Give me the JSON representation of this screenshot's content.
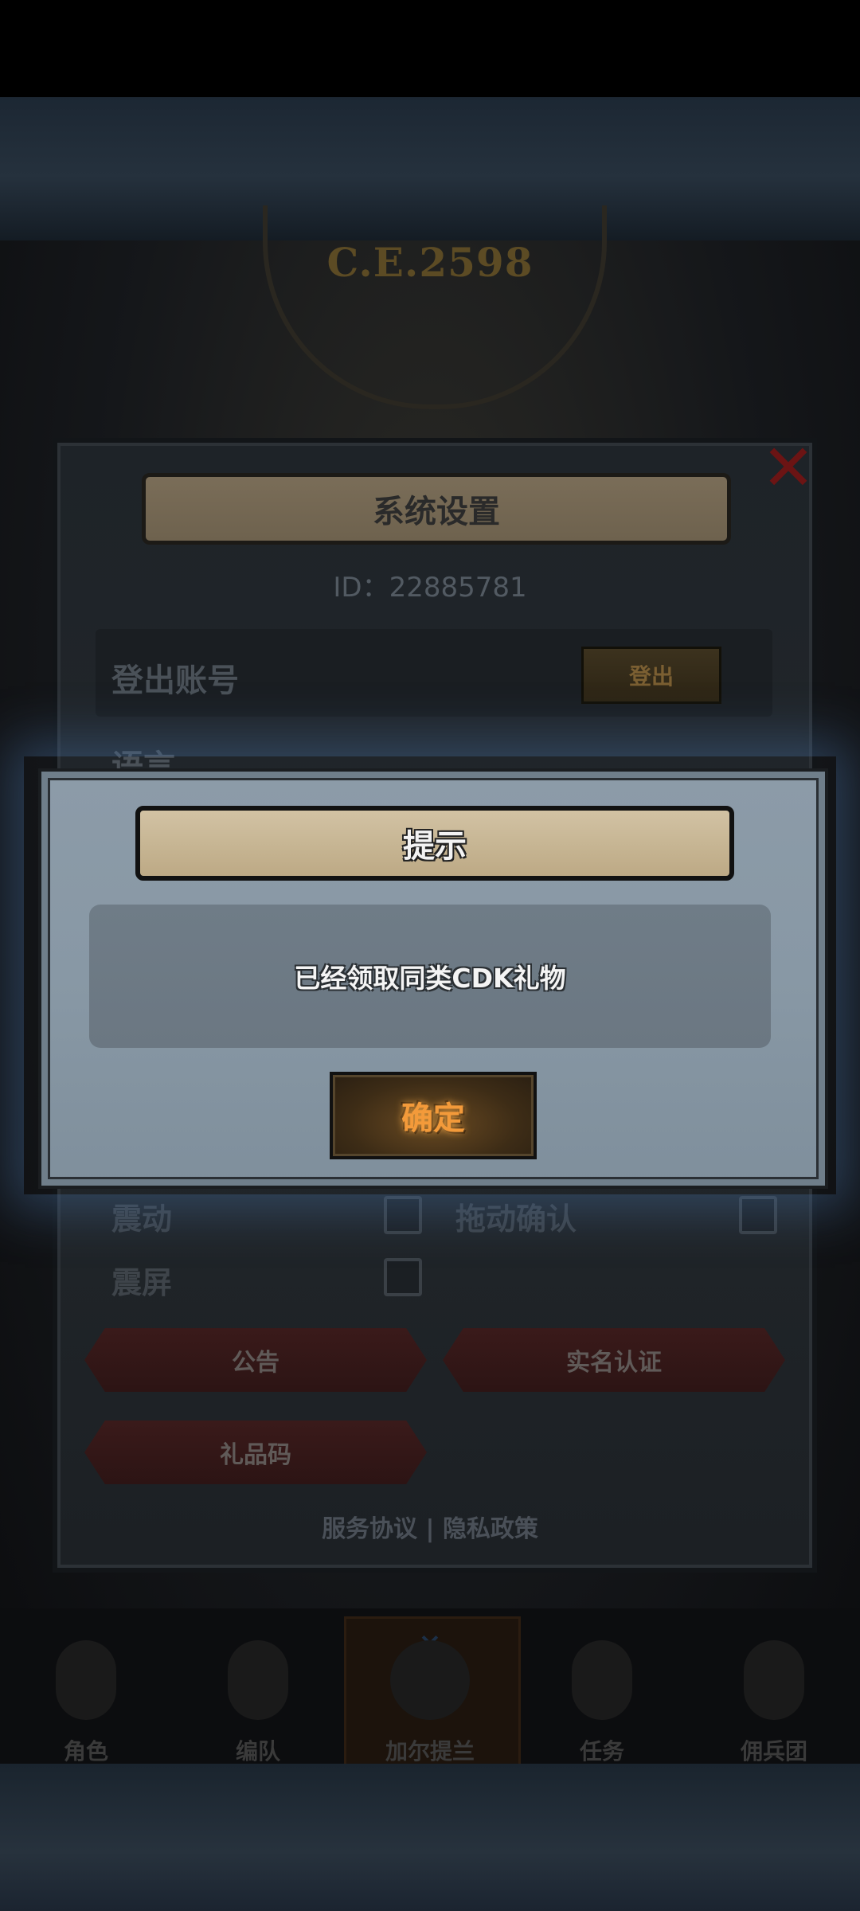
{
  "game_bg": {
    "era": "C.E.2598"
  },
  "settings": {
    "title": "系统设置",
    "user_id": "ID：22885781",
    "logout_label": "登出账号",
    "logout_button": "登出",
    "language_label": "语言",
    "vibration_label": "震动",
    "drag_confirm_label": "拖动确认",
    "screen_shake_label": "震屏",
    "announcement_button": "公告",
    "real_name_button": "实名认证",
    "gift_code_button": "礼品码",
    "service_agreement": "服务协议",
    "separator": "|",
    "privacy_policy": "隐私政策"
  },
  "bottom_nav": {
    "items": [
      {
        "label": "角色"
      },
      {
        "label": "编队"
      },
      {
        "label": "加尔提兰"
      },
      {
        "label": "任务"
      },
      {
        "label": "佣兵团"
      }
    ]
  },
  "dialog": {
    "title": "提示",
    "message": "已经领取同类CDK礼物",
    "confirm_label": "确定"
  },
  "colors": {
    "dialog_bg": "#8898a5",
    "confirm_text": "#f39a3a",
    "banner": "#c7b694"
  }
}
